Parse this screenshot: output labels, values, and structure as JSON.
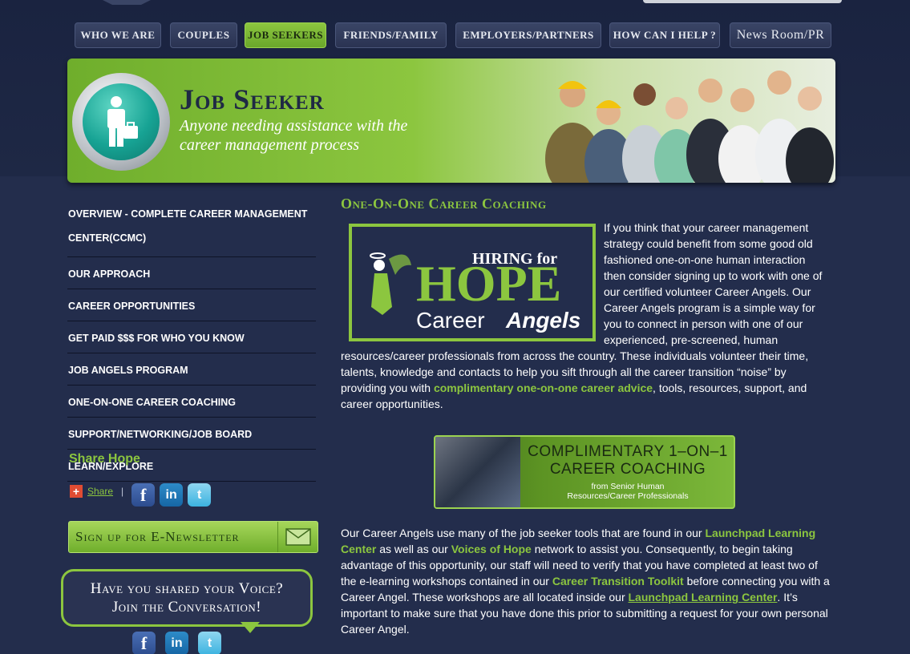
{
  "nav": {
    "items": [
      {
        "label": "WHO WE ARE"
      },
      {
        "label": "COUPLES"
      },
      {
        "label": "JOB SEEKERS"
      },
      {
        "label": "FRIENDS/FAMILY"
      },
      {
        "label": "EMPLOYERS/PARTNERS"
      },
      {
        "label": "HOW CAN I HELP ?"
      },
      {
        "label": "News Room/PR"
      }
    ],
    "active": "JOB SEEKERS"
  },
  "banner": {
    "title": "Job Seeker",
    "subtitle": "Anyone needing assistance with the career management process"
  },
  "sidebar": {
    "items": [
      {
        "label": "OVERVIEW - COMPLETE CAREER MANAGEMENT CENTER(CCMC)"
      },
      {
        "label": "OUR APPROACH"
      },
      {
        "label": "CAREER OPPORTUNITIES"
      },
      {
        "label": "GET PAID $$$ FOR WHO YOU KNOW"
      },
      {
        "label": "JOB ANGELS PROGRAM"
      },
      {
        "label": "ONE-ON-ONE CAREER COACHING"
      },
      {
        "label": "SUPPORT/NETWORKING/JOB BOARD"
      },
      {
        "label": "LEARN/EXPLORE"
      }
    ],
    "share_title": "Share Hope",
    "share_link": "Share",
    "share_separator": "|",
    "newsletter_label": "Sign up for E-Newsletter",
    "bubble_line1": "Have you shared your Voice?",
    "bubble_line2": "Join the Conversation!"
  },
  "main": {
    "heading": "One-On-One Career Coaching",
    "logo": {
      "hiring_for": "HIRING for",
      "hope": "HOPE",
      "career": "Career",
      "angels": "Angels"
    },
    "p1_a": "If you think that your career management strategy could benefit from some good old fashioned one-on-one human interaction then consider signing up to work with one of our certified volunteer Career Angels. Our Career Angels program is a simple way for you to connect in person with one of our experienced, pre-screened, human resources/career professionals from across the country. These individuals volunteer their time, talents, knowledge and contacts to help you sift through all the career transition “noise” by providing you with ",
    "p1_link": "complimentary one-on-one career advice",
    "p1_b": ", tools, resources, support, and career opportunities.",
    "coaching_banner": {
      "title_line1": "COMPLIMENTARY 1–ON–1",
      "title_line2": "CAREER COACHING",
      "sub_line1": "from Senior Human",
      "sub_line2": "Resources/Career Professionals"
    },
    "p2_a": "Our Career Angels use many of the job seeker tools that are found in our ",
    "p2_link1": "Launchpad Learning Center",
    "p2_b": " as well as our ",
    "p2_link2": "Voices of Hope",
    "p2_c": " network to assist you. Consequently, to begin taking advantage of this opportunity, our staff will need to verify that you have completed at least two of the e-learning workshops contained in our ",
    "p2_link3": "Career Transition Toolkit",
    "p2_d": " before connecting you with a Career Angel. These workshops are all located inside our ",
    "p2_link4": "Launchpad Learning Center",
    "p2_e": ". It’s important to make sure that you have done this prior to submitting a request for your own personal Career Angel."
  },
  "colors": {
    "accent": "#8cc63f",
    "background": "#232d4c",
    "header_band": "#1a2340"
  },
  "icons": [
    "plus-icon",
    "facebook-icon",
    "linkedin-icon",
    "twitter-icon",
    "mail-icon",
    "briefcase-person-icon"
  ]
}
